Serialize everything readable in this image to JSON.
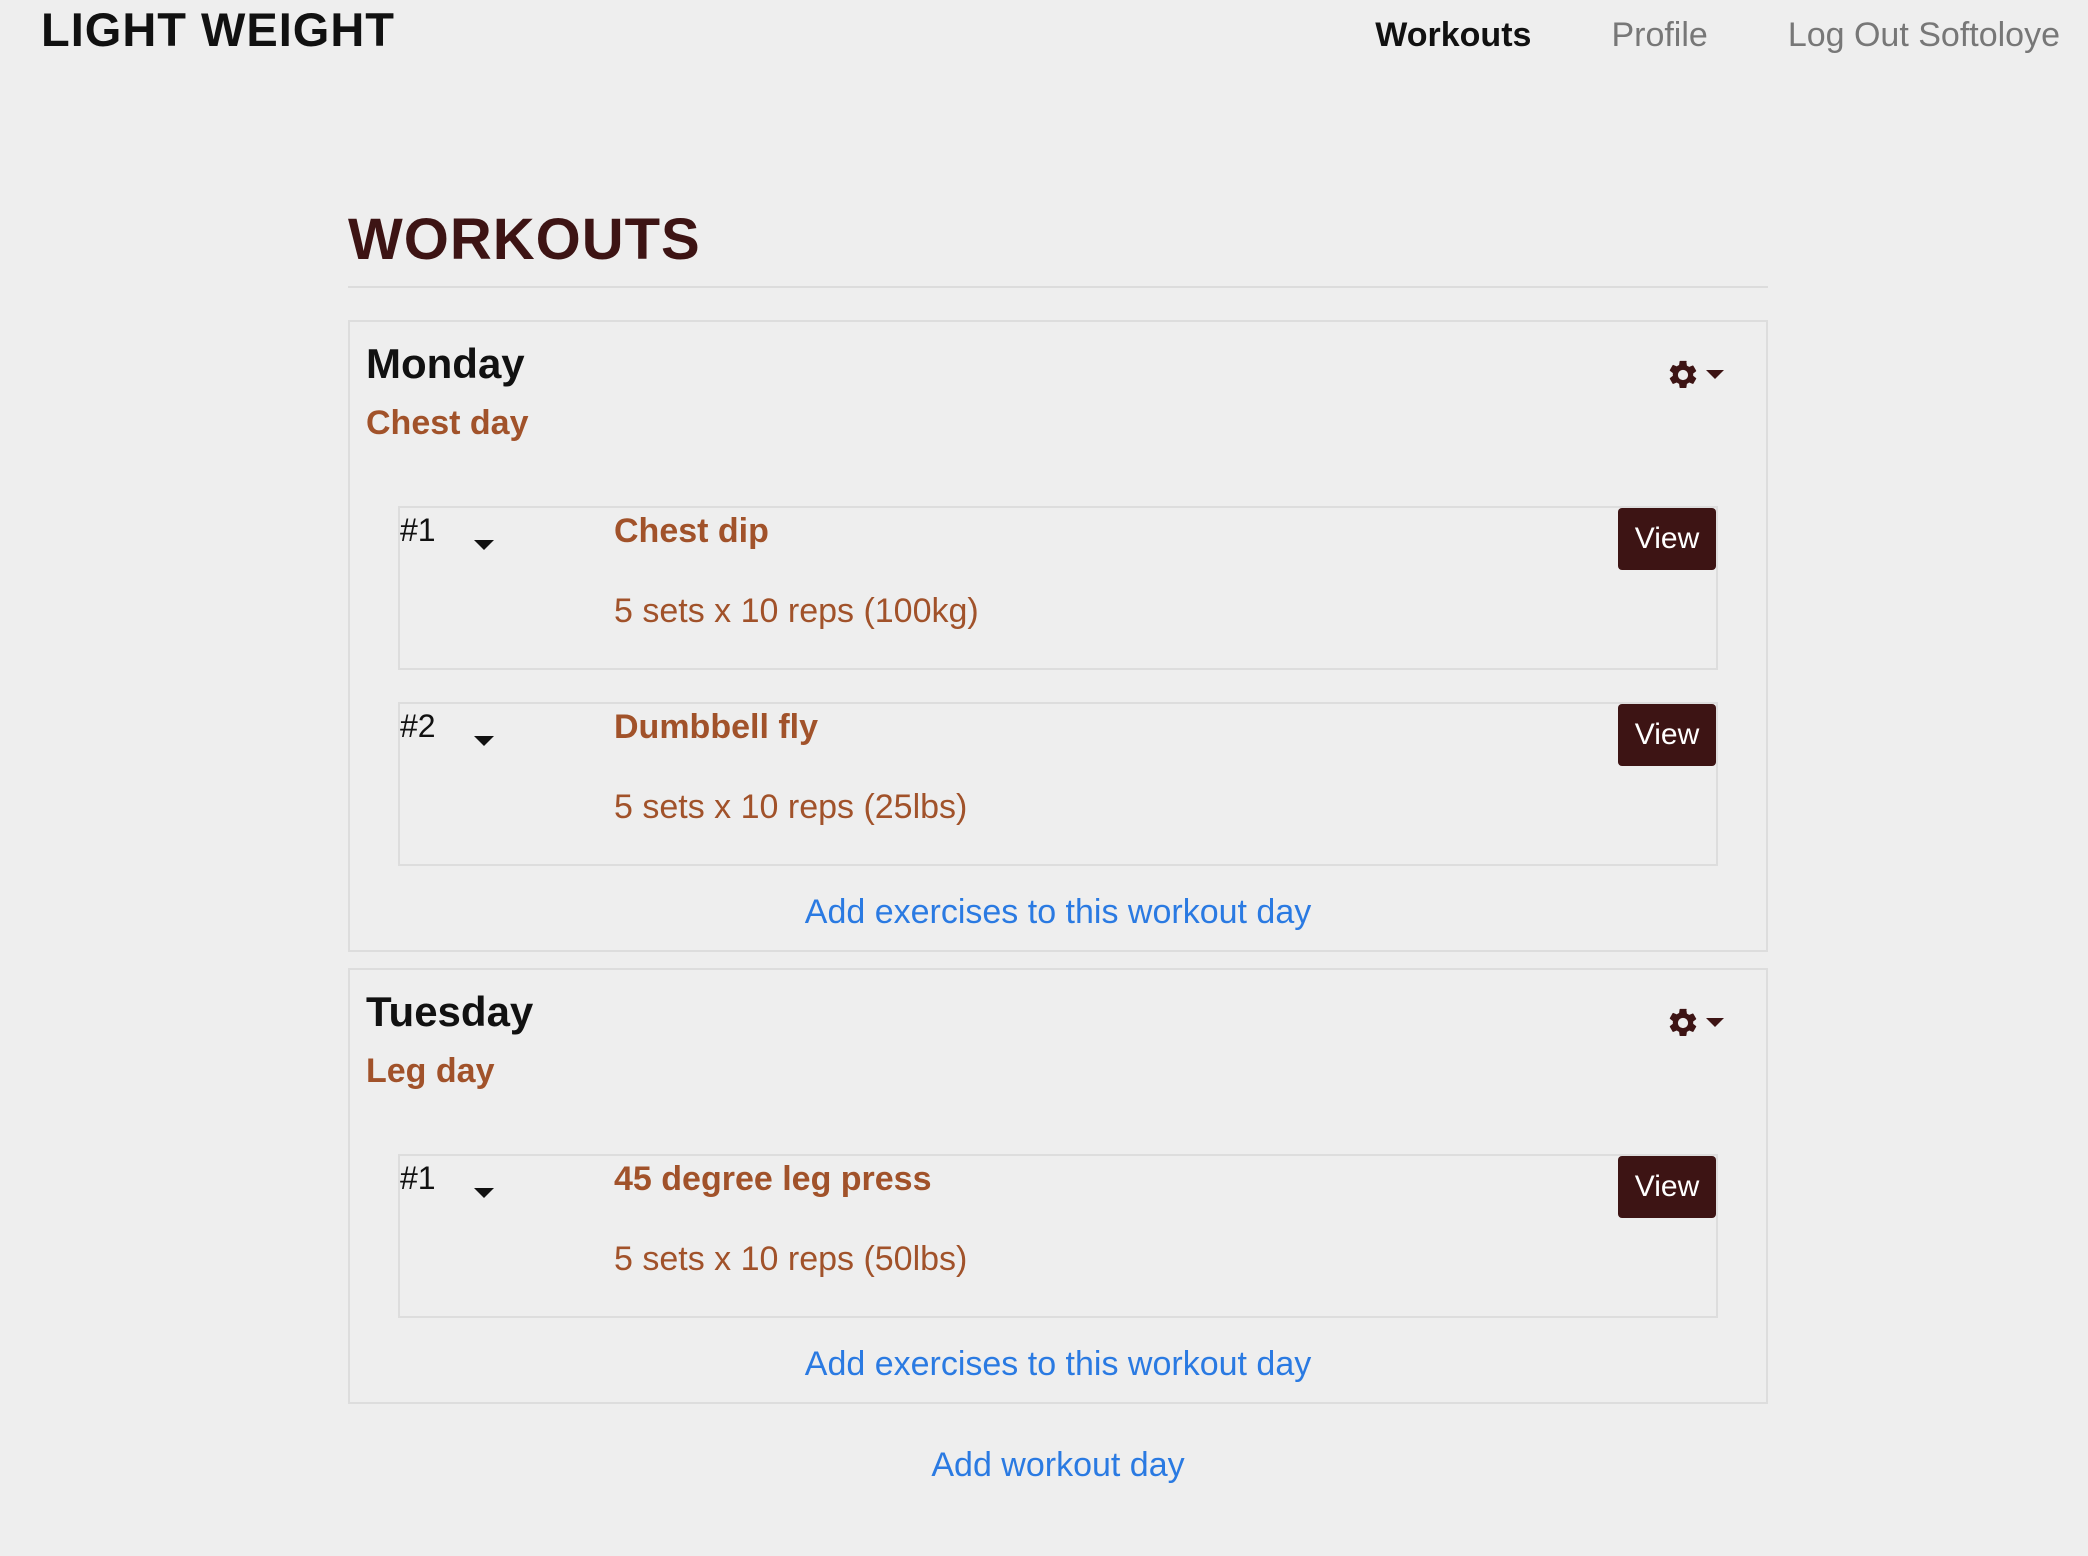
{
  "brand": "LIGHT WEIGHT",
  "nav": {
    "workouts": "Workouts",
    "profile": "Profile",
    "logout": "Log Out Softoloye"
  },
  "page_title": "WORKOUTS",
  "days": [
    {
      "name": "Monday",
      "subtitle": "Chest day",
      "exercises": [
        {
          "num": "#1",
          "name": "Chest dip",
          "detail": "5 sets x 10 reps (100kg)",
          "button": "View"
        },
        {
          "num": "#2",
          "name": "Dumbbell fly",
          "detail": "5 sets x 10 reps (25lbs)",
          "button": "View"
        }
      ],
      "add_label": "Add exercises to this workout day"
    },
    {
      "name": "Tuesday",
      "subtitle": "Leg day",
      "exercises": [
        {
          "num": "#1",
          "name": "45 degree leg press",
          "detail": "5 sets x 10 reps (50lbs)",
          "button": "View"
        }
      ],
      "add_label": "Add exercises to this workout day"
    }
  ],
  "add_day_label": "Add workout day",
  "colors": {
    "accent_dark": "#3d1414",
    "accent_brown": "#a1522a",
    "link_blue": "#2a7ae2",
    "background": "#eeeeee"
  },
  "icons": {
    "settings": "gear-icon",
    "dropdown": "caret-down-icon"
  }
}
